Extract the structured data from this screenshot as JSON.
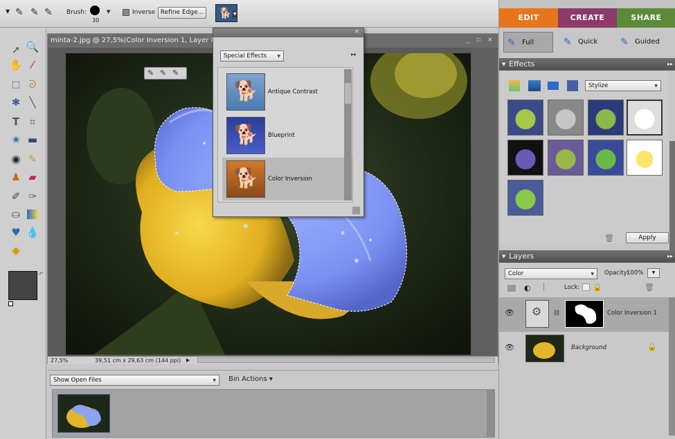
{
  "options_bar": {
    "brush_label": "Brush:",
    "brush_size": "30",
    "inverse_label": "Inverse",
    "refine_edge_label": "Refine Edge..."
  },
  "document": {
    "title": "minta-2.jpg @ 27,5%(Color Inversion 1, Layer M",
    "zoom": "27,5%",
    "doc_size": "39,51 cm x 29,63 cm (144 ppi)"
  },
  "popup": {
    "category": "Special Effects",
    "items": [
      {
        "label": "Antique Contrast"
      },
      {
        "label": "Blueprint"
      },
      {
        "label": "Color Inversion",
        "selected": true
      }
    ]
  },
  "bin": {
    "show_label": "Show Open Files",
    "actions_label": "Bin Actions"
  },
  "tabs": {
    "edit": "EDIT",
    "create": "CREATE",
    "share": "SHARE",
    "edit_color": "#e8741c",
    "create_color": "#8c3a6a",
    "share_color": "#5a8a3a"
  },
  "modes": {
    "full": "Full",
    "quick": "Quick",
    "guided": "Guided"
  },
  "effects": {
    "title": "Effects",
    "category": "Stylize",
    "apply_label": "Apply"
  },
  "layers": {
    "title": "Layers",
    "blend_mode": "Color",
    "opacity_label": "Opacity:",
    "opacity_value": "100%",
    "lock_label": "Lock:",
    "items": [
      {
        "name": "Color Inversion 1"
      },
      {
        "name": "Background"
      }
    ]
  }
}
